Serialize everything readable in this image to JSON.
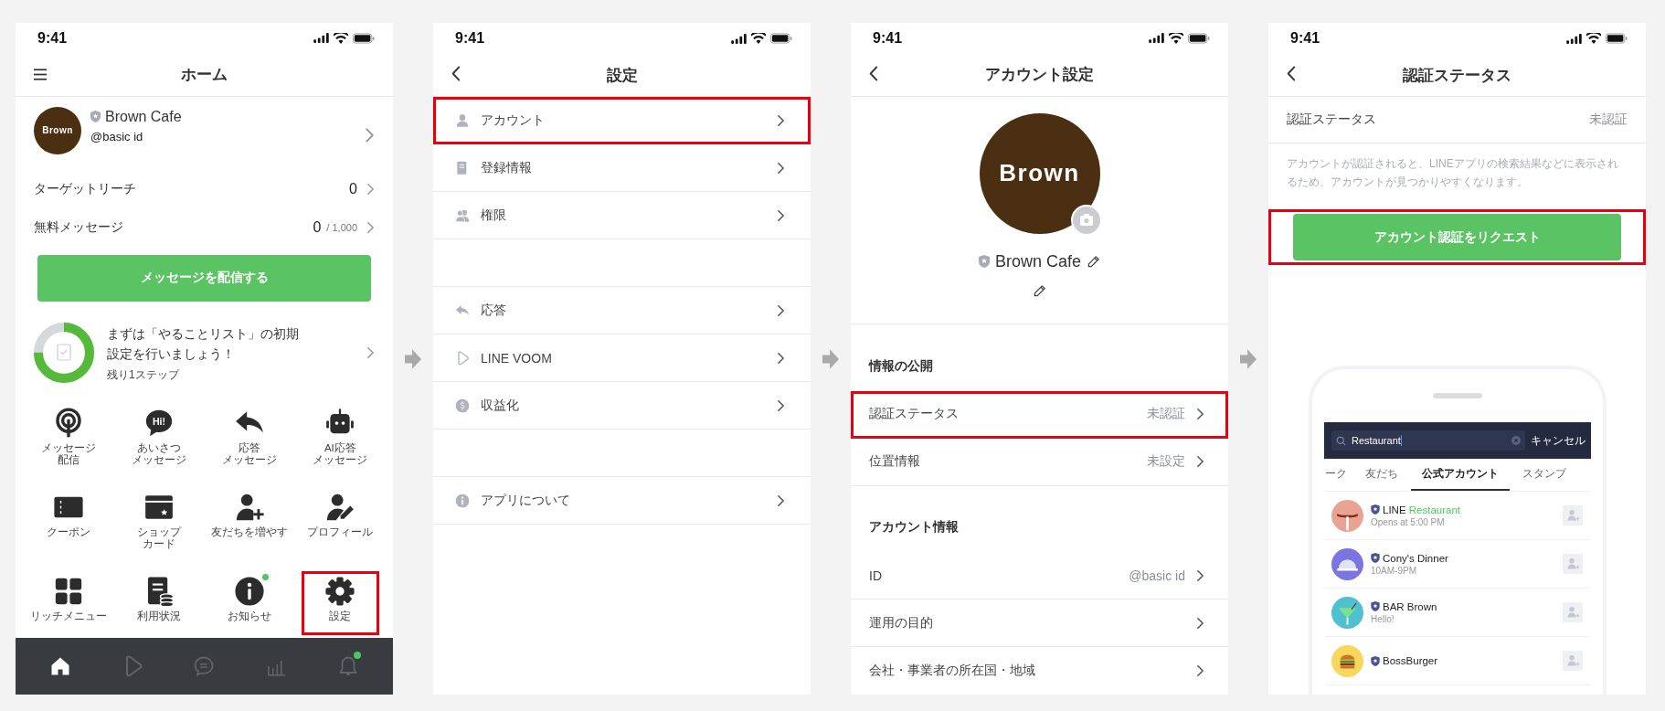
{
  "screens": [
    {
      "kind": "home",
      "time": "9:41",
      "title": "ホーム",
      "profile": {
        "avatar_text": "Brown",
        "name": "Brown Cafe",
        "basic_id": "@basic id"
      },
      "stats": [
        {
          "label": "ターゲットリーチ",
          "value": "0"
        },
        {
          "label": "無料メッセージ",
          "value": "0",
          "limit": "/ 1,000"
        }
      ],
      "send_button": "メッセージを配信する",
      "todo": {
        "level": 0.75,
        "text_lines": [
          "まずは「やることリスト」の初期",
          "設定を行いましょう！"
        ],
        "remaining": "残り1ステップ"
      },
      "shortcuts": [
        {
          "kind": "broadcast",
          "lines": [
            "メッセージ",
            "配信"
          ],
          "highlighted": false,
          "badge": false
        },
        {
          "kind": "hi",
          "icon_text": "Hi!",
          "lines": [
            "あいさつ",
            "メッセージ"
          ],
          "highlighted": false,
          "badge": false
        },
        {
          "kind": "reply",
          "lines": [
            "応答",
            "メッセージ"
          ],
          "highlighted": false,
          "badge": false
        },
        {
          "kind": "bot",
          "lines": [
            "AI応答",
            "メッセージ"
          ],
          "highlighted": false,
          "badge": false
        },
        {
          "kind": "coupon",
          "lines": [
            "クーポン"
          ],
          "highlighted": false,
          "badge": false
        },
        {
          "kind": "card",
          "lines": [
            "ショップ",
            "カード"
          ],
          "highlighted": false,
          "badge": false
        },
        {
          "kind": "addfriend",
          "lines": [
            "友だちを増やす"
          ],
          "highlighted": false,
          "badge": false
        },
        {
          "kind": "profile",
          "lines": [
            "プロフィール"
          ],
          "highlighted": false,
          "badge": false
        },
        {
          "kind": "grid",
          "lines": [
            "リッチメニュー"
          ],
          "highlighted": false,
          "badge": false
        },
        {
          "kind": "usage",
          "lines": [
            "利用状況"
          ],
          "highlighted": false,
          "badge": false
        },
        {
          "kind": "info",
          "lines": [
            "お知らせ"
          ],
          "highlighted": false,
          "badge": true
        },
        {
          "kind": "gear",
          "lines": [
            "設定"
          ],
          "highlighted": true,
          "badge": false
        }
      ],
      "tab_bar": [
        {
          "kind": "home",
          "selected": true,
          "badge": false
        },
        {
          "kind": "voom",
          "selected": false,
          "badge": false
        },
        {
          "kind": "chat",
          "selected": false,
          "badge": false
        },
        {
          "kind": "chart",
          "selected": false,
          "badge": false
        },
        {
          "kind": "bell",
          "selected": false,
          "badge": true
        }
      ]
    },
    {
      "kind": "settings",
      "time": "9:41",
      "title": "設定",
      "groups": [
        [
          {
            "kind": "person",
            "label": "アカウント",
            "highlighted": true
          },
          {
            "kind": "doc",
            "label": "登録情報",
            "highlighted": false
          },
          {
            "kind": "people",
            "label": "権限",
            "highlighted": false
          }
        ],
        [
          {
            "kind": "reply",
            "label": "応答",
            "highlighted": false
          },
          {
            "kind": "voom",
            "label": "LINE VOOM",
            "highlighted": false
          },
          {
            "kind": "coin",
            "label": "収益化",
            "highlighted": false
          }
        ],
        [
          {
            "kind": "info",
            "label": "アプリについて",
            "highlighted": false
          }
        ]
      ]
    },
    {
      "kind": "account",
      "time": "9:41",
      "title": "アカウント設定",
      "avatar_text": "Brown",
      "name": "Brown Cafe",
      "sections": [
        {
          "title": "情報の公開",
          "rows": [
            {
              "label": "認証ステータス",
              "value": "未認証",
              "highlighted": true
            },
            {
              "label": "位置情報",
              "value": "未設定",
              "highlighted": false
            }
          ]
        },
        {
          "title": "アカウント情報",
          "rows": [
            {
              "label": "ID",
              "value": "@basic id",
              "highlighted": false
            },
            {
              "label": "運用の目的",
              "highlighted": false
            },
            {
              "label": "会社・事業者の所在国・地域",
              "highlighted": false
            }
          ]
        }
      ]
    },
    {
      "kind": "verification",
      "time": "9:41",
      "title": "認証ステータス",
      "status": {
        "label": "認証ステータス",
        "value": "未認証"
      },
      "description": "アカウントが認証されると、LINEアプリの検索結果などに表示されるため、アカウントが見つかりやすくなります。",
      "button": {
        "label": "アカウント認証をリクエスト",
        "highlighted": true
      },
      "preview": {
        "search_value": "Restaurant",
        "cancel": "キャンセル",
        "tabs": [
          {
            "label": "ーク",
            "selected": false
          },
          {
            "label": "友だち",
            "selected": false
          },
          {
            "label": "公式アカウント",
            "selected": true
          },
          {
            "label": "スタンプ",
            "selected": false
          }
        ],
        "results": [
          {
            "kind": "sausage",
            "color": "#e9a393",
            "name": "LINE",
            "match": "Restaurant",
            "subtitle": "Opens at 5:00 PM"
          },
          {
            "kind": "cloche",
            "color": "#7c74e3",
            "name": "Cony's Dinner",
            "subtitle": "10AM-9PM"
          },
          {
            "kind": "cocktail",
            "color": "#4fc0cf",
            "name": "BAR Brown",
            "subtitle": "Hello!"
          },
          {
            "kind": "burger",
            "color": "#f7d85c",
            "name": "BossBurger"
          }
        ]
      }
    }
  ]
}
